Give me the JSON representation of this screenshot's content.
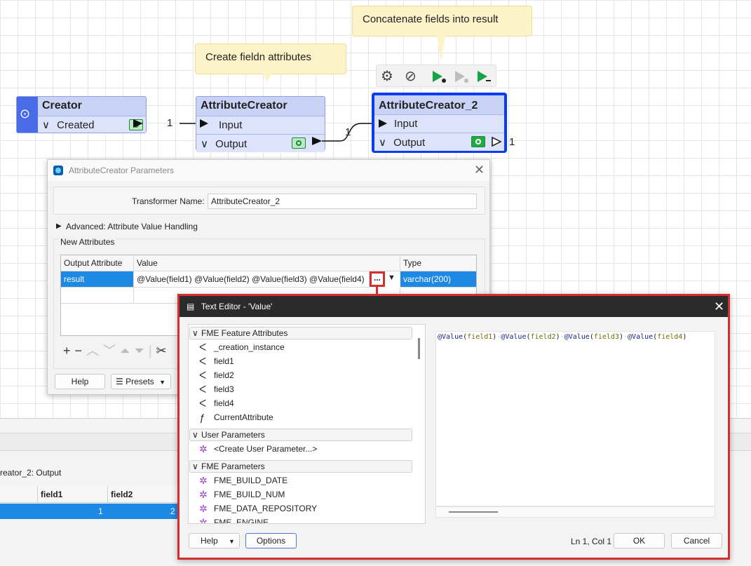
{
  "annotations": {
    "left": "Create fieldn attributes",
    "right": "Concatenate fields into result"
  },
  "nodes": {
    "creator": {
      "title": "Creator",
      "port": "Created",
      "count": "1"
    },
    "attr1": {
      "title": "AttributeCreator",
      "input": "Input",
      "output": "Output",
      "count": "1"
    },
    "attr2": {
      "title": "AttributeCreator_2",
      "input": "Input",
      "output": "Output",
      "count": "1"
    }
  },
  "params_dialog": {
    "title": "AttributeCreator Parameters",
    "transformer_name_label": "Transformer Name:",
    "transformer_name_value": "AttributeCreator_2",
    "advanced_label": "Advanced: Attribute Value Handling",
    "new_attributes_label": "New Attributes",
    "columns": [
      "Output Attribute",
      "Value",
      "Type"
    ],
    "row": {
      "attribute": "result",
      "value": "@Value(field1) @Value(field2) @Value(field3) @Value(field4)",
      "ellipsis": "...",
      "type": "varchar(200)"
    },
    "help_label": "Help",
    "presets_label": "Presets"
  },
  "bottom_panel": {
    "tab_label": "reator_2: Output",
    "columns": [
      "field1",
      "field2"
    ],
    "row_values": [
      "1",
      "2"
    ]
  },
  "text_editor": {
    "title": "Text Editor - 'Value'",
    "sections": {
      "feature_attributes": {
        "label": "FME Feature Attributes",
        "items": [
          "_creation_instance",
          "field1",
          "field2",
          "field3",
          "field4",
          "CurrentAttribute"
        ]
      },
      "user_parameters": {
        "label": "User Parameters",
        "items": [
          "<Create User Parameter...>"
        ]
      },
      "fme_parameters": {
        "label": "FME Parameters",
        "items": [
          "FME_BUILD_DATE",
          "FME_BUILD_NUM",
          "FME_DATA_REPOSITORY",
          "FME_ENGINE"
        ]
      }
    },
    "code": {
      "fn": "@Value",
      "args": [
        "field1",
        "field2",
        "field3",
        "field4"
      ]
    },
    "status": "Ln 1, Col 1",
    "help_label": "Help",
    "options_label": "Options",
    "ok_label": "OK",
    "cancel_label": "Cancel"
  },
  "colors": {
    "node_fill": "#c9d3f6",
    "selected_border": "#0a3cf0",
    "annotation": "#fdf3c8",
    "highlight_red": "#d32f2f",
    "row_selected": "#1e88e5"
  }
}
